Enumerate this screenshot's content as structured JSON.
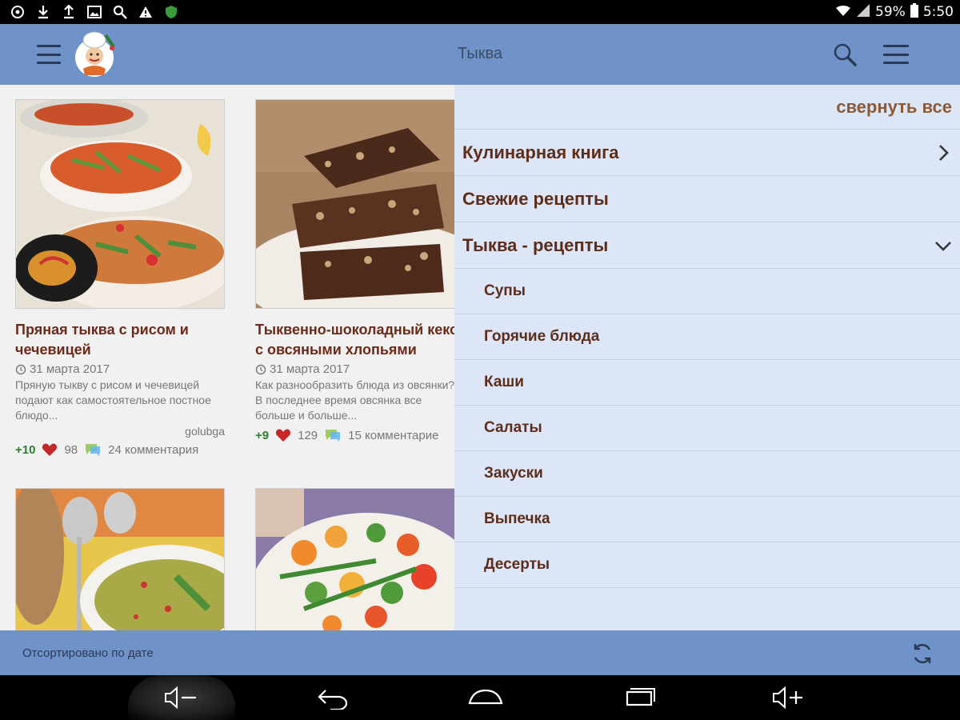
{
  "status_bar": {
    "battery": "59%",
    "time": "5:50",
    "icons": [
      "settings-icon",
      "download-icon",
      "upload-icon",
      "image-icon",
      "search-icon",
      "warning-icon",
      "shield-icon",
      "wifi-icon",
      "signal-icon",
      "battery-icon"
    ]
  },
  "app_bar": {
    "title": "Тыква",
    "icons": [
      "menu-icon",
      "chef-logo",
      "search-icon",
      "overflow-menu-icon"
    ]
  },
  "recipes": [
    {
      "title": "Пряная тыква с рисом и чечевицей",
      "date": "31 марта 2017",
      "description": "Пряную тыкву с рисом и чечевицей подают как самостоятельное постное блюдо...",
      "author": "golubga",
      "score": "+10",
      "likes": "98",
      "comments": "24 комментария"
    },
    {
      "title": "Тыквенно-шоколадный кекс с овсяными хлопьями",
      "date": "31 марта 2017",
      "description": "Как разнообразить блюда из овсянки? В последнее время овсянка все больше и больше...",
      "author": "",
      "score": "+9",
      "likes": "129",
      "comments": "15 комментарие"
    }
  ],
  "drawer": {
    "collapse_all": "свернуть все",
    "items": [
      {
        "label": "Кулинарная книга"
      },
      {
        "label": "Свежие рецепты"
      },
      {
        "label": "Тыква - рецепты"
      }
    ],
    "subitems": [
      {
        "label": "Супы"
      },
      {
        "label": "Горячие блюда"
      },
      {
        "label": "Каши"
      },
      {
        "label": "Салаты"
      },
      {
        "label": "Закуски"
      },
      {
        "label": "Выпечка"
      },
      {
        "label": "Десерты"
      }
    ]
  },
  "bottom_bar": {
    "sort_label": "Отсортировано по дате"
  },
  "nav_bar": {
    "icons": [
      "volume-down-icon",
      "back-icon",
      "home-icon",
      "recents-icon",
      "volume-up-icon"
    ]
  },
  "colors": {
    "app_bar": "#6f93c9",
    "drawer_bg": "#dde6f6",
    "title_brown": "#6b2a1a",
    "score_green": "#2e7d32"
  }
}
